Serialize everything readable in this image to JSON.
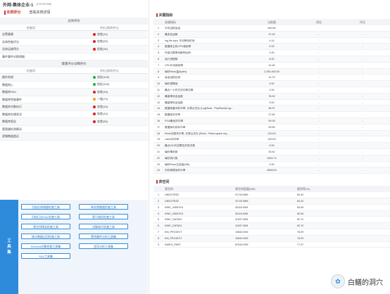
{
  "header": {
    "title": "外网-集体企业-1",
    "subtitle": "(2747297998)"
  },
  "left_tabs": [
    {
      "label": "实例评分"
    },
    {
      "label": "查看实例详情"
    }
  ],
  "overall": {
    "section_title": "总体评价",
    "col_check": "检查项",
    "col_score": "评价(扣除评分)",
    "rows": [
      {
        "label": "告警健康",
        "status_color": "#e02020",
        "value": "较差(41)"
      },
      {
        "label": "总体性能评分",
        "status_color": "#e02020",
        "value": "较差(52)"
      },
      {
        "label": "总体运维得分",
        "status_color": "#e02020",
        "value": "很差(30)"
      },
      {
        "label": "事件事件对照明细",
        "status_color": "",
        "value": ""
      }
    ]
  },
  "health": {
    "section_title": "健康评分详细评价",
    "col_check": "检查项",
    "col_score": "评价(扣除评分)",
    "rows": [
      {
        "label": "操作系统",
        "status_color": "#2ea84a",
        "value": "良好(100)"
      },
      {
        "label": "数据库()",
        "status_color": "#2ea84a",
        "value": "良好(100)"
      },
      {
        "label": "数据库RAC",
        "status_color": "#e02020",
        "value": "较差(15)"
      },
      {
        "label": "数据库性能事件",
        "status_color": "#f0a020",
        "value": "一般(70)"
      },
      {
        "label": "数据库对象执行",
        "status_color": "#e02020",
        "value": "较差(15)"
      },
      {
        "label": "数据库存储状况",
        "status_color": "#e02020",
        "value": "较差(10)"
      },
      {
        "label": "数据库报告",
        "status_color": "#e02020",
        "value": "较差(50)"
      },
      {
        "label": "管理器检测情况",
        "status_color": "",
        "value": ""
      },
      {
        "label": "逻辑数据超远",
        "status_color": "",
        "value": ""
      }
    ]
  },
  "tools": {
    "label_chars": [
      "工",
      "具",
      "集"
    ],
    "buttons": [
      "归档在线增量检查工具",
      "单实例数据检查工具",
      "归档日志SQL检查工具",
      "索引调优检查工具",
      "表空间增长检查工具",
      "对象碎片检查工具",
      "统计数据过旧检查工具",
      "等待事件分析工具集",
      "Schema对象检查工具集",
      "会话分析工具集",
      "SQL工具集"
    ]
  },
  "key_metrics": {
    "title": "关键指标",
    "headers": [
      "",
      "关键指标",
      "当前值",
      "同比",
      "环比"
    ],
    "rows": [
      [
        "1",
        "平均活跃会话",
        "645.80",
        "-",
        "-"
      ],
      [
        "2",
        "最多会话数",
        "37.00",
        "-",
        "-"
      ],
      [
        "3",
        "log file sync 平均等待时间",
        "4.14",
        "-",
        "-"
      ],
      [
        "4",
        "数据库主机CPU使用率",
        "0.00",
        "-",
        "-"
      ],
      [
        "5",
        "外部过载等待影响比例",
        "1.00",
        "-",
        "-"
      ],
      [
        "6",
        "运行进程数",
        "8.00",
        "-",
        "-"
      ],
      [
        "7",
        "CPU平均使用率",
        "14.40",
        "-",
        "-"
      ],
      [
        "8",
        "每秒Redo量(bytes)",
        "2,250,463.00",
        "-",
        "-"
      ],
      [
        "9",
        "会话活跃比例",
        "14.75",
        "-",
        "-"
      ],
      [
        "10",
        "每秒逻辑读",
        "3.00",
        "-",
        "-"
      ],
      [
        "11",
        "最近一小时日志切换次数",
        "3.00",
        "-",
        "-"
      ],
      [
        "12",
        "最高等待会话数",
        "78.00",
        "-",
        "-"
      ],
      [
        "13",
        "最高等待会话数",
        "3.00",
        "-",
        "-"
      ],
      [
        "14",
        "数据库缓冲命中率, 计算公式为 (LogRead - PhyRead)/Log...",
        "98.97",
        "-",
        "-"
      ],
      [
        "15",
        "数据库命中率",
        "27.50",
        "-",
        "-"
      ],
      [
        "16",
        "PGA最优命中率",
        "99.28",
        "-",
        "-"
      ],
      [
        "17",
        "数据库内存命中率",
        "99.89",
        "-",
        "-"
      ],
      [
        "18",
        "Redo分配命中率, 计算公式为 (Redo - Redo space req...",
        "100.00",
        "-",
        "-"
      ],
      [
        "19",
        "Latch命中率",
        "100.00",
        "-",
        "-"
      ],
      [
        "20",
        "最近24h内告警告失败次数",
        "0.00",
        "-",
        "-"
      ],
      [
        "21",
        "每秒事务数",
        "33.51",
        "-",
        "-"
      ],
      [
        "22",
        "每秒执行数",
        "4264.72",
        "-",
        "-"
      ],
      [
        "23",
        "每秒Redo生成量(MB)",
        "2.00",
        "-",
        "-"
      ],
      [
        "24",
        "内存物理读命中率",
        "6468.00",
        "-",
        "-"
      ]
    ]
  },
  "tablespace": {
    "title": "表空间",
    "headers": [
      "",
      "表空间",
      "表空间容量(MB)",
      "使用率(%)"
    ],
    "rows": [
      [
        "1",
        "UNDOTBS2",
        "31743.98M",
        "84.42"
      ],
      [
        "2",
        "UNDOTBS2",
        "31743.98M",
        "84.42"
      ],
      [
        "3",
        "INNC_INDEX01",
        "26116.00M",
        "83.06"
      ],
      [
        "4",
        "INNC_INDEX01",
        "26116.00M",
        "83.06"
      ],
      [
        "5",
        "INNC_DATA01",
        "11637.00M",
        "82.12"
      ],
      [
        "6",
        "INNC_DATA01",
        "11637.00M",
        "82.12"
      ],
      [
        "7",
        "EM_PROJECT",
        "10840.00M",
        "78.09"
      ],
      [
        "8",
        "EM_PROJECT",
        "10840.00M",
        "78.09"
      ],
      [
        "9",
        "INDEX_PART",
        "87040.00M",
        "77.37"
      ]
    ]
  },
  "watermark": {
    "text": "白鳝的洞穴"
  }
}
